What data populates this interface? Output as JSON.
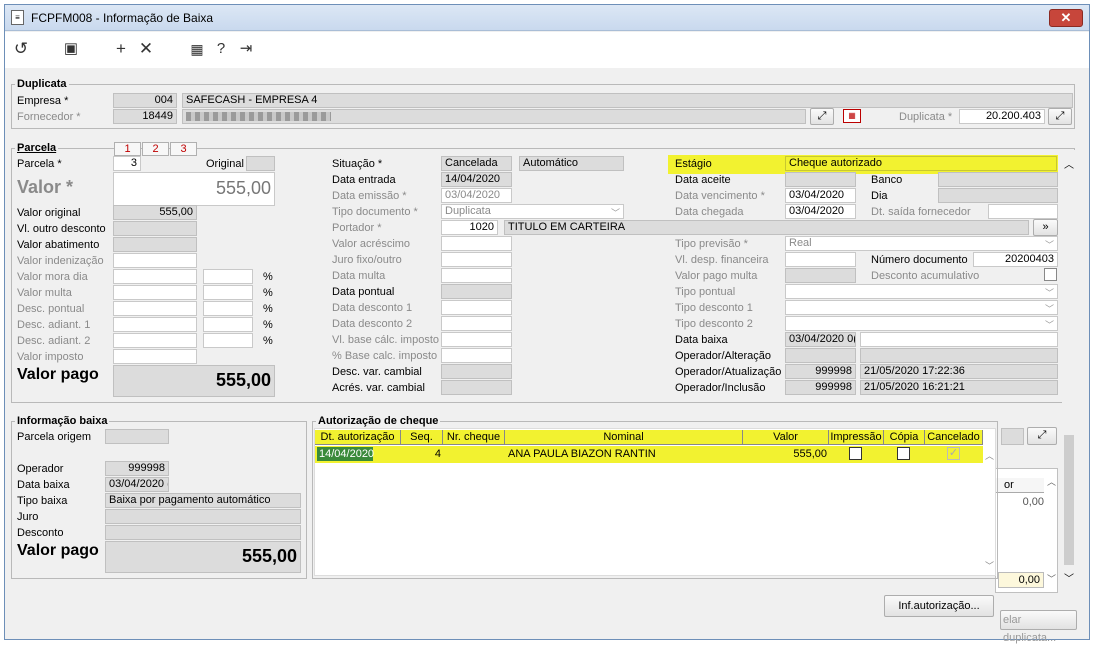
{
  "window": {
    "title": "FCPFM008 - Informação de Baixa"
  },
  "toolbar": {
    "undo": "undo-icon",
    "save": "save-icon",
    "add": "plus-icon",
    "cancel": "close-icon",
    "calendar": "calendar-icon",
    "help": "help-icon",
    "exit": "exit-icon"
  },
  "duplicata": {
    "title": "Duplicata",
    "empresa_label": "Empresa *",
    "empresa_code": "004",
    "empresa_name": "SAFECASH -  EMPRESA 4",
    "fornecedor_label": "Fornecedor *",
    "fornecedor_code": "18449",
    "duplicata_label": "Duplicata *",
    "duplicata_value": "20.200.403"
  },
  "parcela": {
    "title": "Parcela",
    "tabs": [
      "1",
      "2",
      "3"
    ],
    "parcela_label": "Parcela *",
    "parcela_value": "3",
    "original_label": "Original",
    "valor_label": "Valor *",
    "valor_value": "555,00",
    "valor_original_label": "Valor original",
    "valor_original_value": "555,00",
    "vl_outro_desconto_label": "Vl. outro desconto",
    "valor_abatimento_label": "Valor abatimento",
    "valor_indenizacao_label": "Valor indenização",
    "valor_mora_dia_label": "Valor mora dia",
    "valor_multa_label": "Valor multa",
    "desc_pontual_label": "Desc. pontual",
    "desc_adiant1_label": "Desc. adiant. 1",
    "desc_adiant2_label": "Desc. adiant. 2",
    "valor_imposto_label": "Valor imposto",
    "pct": "%",
    "valor_pago_label": "Valor pago",
    "valor_pago_value": "555,00"
  },
  "middle": {
    "situacao_label": "Situação *",
    "situacao_value": "Cancelada",
    "situacao_tipo": "Automático",
    "data_entrada_label": "Data entrada",
    "data_entrada_value": "14/04/2020",
    "data_emissao_label": "Data emissão *",
    "data_emissao_value": "03/04/2020",
    "tipo_documento_label": "Tipo documento *",
    "tipo_documento_value": "Duplicata",
    "portador_label": "Portador *",
    "portador_code": "1020",
    "portador_name": "TITULO EM CARTEIRA",
    "valor_acrescimo_label": "Valor acréscimo",
    "juro_fixo_label": "Juro fixo/outro",
    "data_multa_label": "Data multa",
    "data_pontual_label": "Data pontual",
    "data_desconto1_label": "Data desconto 1",
    "data_desconto2_label": "Data desconto 2",
    "vl_base_calc_label": "Vl. base cálc. imposto",
    "pct_base_calc_label": "% Base calc. imposto",
    "desc_var_cambial_label": "Desc. var. cambial",
    "acres_var_cambial_label": "Acrés. var. cambial"
  },
  "right": {
    "estagio_label": "Estágio",
    "estagio_value": "Cheque autorizado",
    "data_aceite_label": "Data aceite",
    "banco_label": "Banco",
    "dia_label": "Dia",
    "data_vencimento_label": "Data vencimento *",
    "data_vencimento_value": "03/04/2020",
    "data_chegada_label": "Data chegada",
    "data_chegada_value": "03/04/2020",
    "dt_saida_fornecedor_label": "Dt. saída fornecedor",
    "portador_btn": "»",
    "tipo_previsao_label": "Tipo previsão *",
    "tipo_previsao_value": "Real",
    "vl_desp_financeira_label": "Vl. desp. financeira",
    "numero_documento_label": "Número documento",
    "numero_documento_value": "20200403",
    "valor_pago_multa_label": "Valor pago multa",
    "desconto_acumulativo_label": "Desconto acumulativo",
    "tipo_pontual_label": "Tipo pontual",
    "tipo_desconto1_label": "Tipo desconto 1",
    "tipo_desconto2_label": "Tipo desconto 2",
    "data_baixa_label": "Data baixa",
    "data_baixa_value": "03/04/2020 0(",
    "operador_alteracao_label": "Operador/Alteração",
    "operador_atualizacao_label": "Operador/Atualização",
    "operador_atualizacao_code": "999998",
    "operador_atualizacao_date": "21/05/2020 17:22:36",
    "operador_inclusao_label": "Operador/Inclusão",
    "operador_inclusao_code": "999998",
    "operador_inclusao_date": "21/05/2020 16:21:21"
  },
  "info_baixa": {
    "title": "Informação baixa",
    "parcela_origem_label": "Parcela origem",
    "operador_label": "Operador",
    "operador_value": "999998",
    "data_baixa_label": "Data baixa",
    "data_baixa_value": "03/04/2020 (",
    "tipo_baixa_label": "Tipo baixa",
    "tipo_baixa_value": "Baixa por pagamento automático",
    "juro_label": "Juro",
    "desconto_label": "Desconto",
    "valor_pago_label": "Valor pago",
    "valor_pago_value": "555,00"
  },
  "cheque": {
    "title": "Autorização de cheque",
    "columns": [
      "Dt. autorização",
      "Seq.",
      "Nr. cheque",
      "Nominal",
      "Valor",
      "Impressão",
      "Cópia",
      "Cancelado"
    ],
    "rows": [
      {
        "dt": "14/04/2020",
        "seq": "4",
        "nr": "",
        "nominal": "ANA PAULA BIAZON RANTIN",
        "valor": "555,00",
        "impressao": false,
        "copia": false,
        "cancelado": true
      }
    ]
  },
  "behind": {
    "col_label": "or",
    "value1": "0,00",
    "value2": "0,00",
    "btn_cancelar": "elar duplicata..."
  },
  "buttons": {
    "inf_autorizacao": "Inf.autorização..."
  },
  "colors": {
    "highlight": "#f2f230",
    "readonly": "#dcdcdc",
    "selected": "#3a8a3a"
  }
}
